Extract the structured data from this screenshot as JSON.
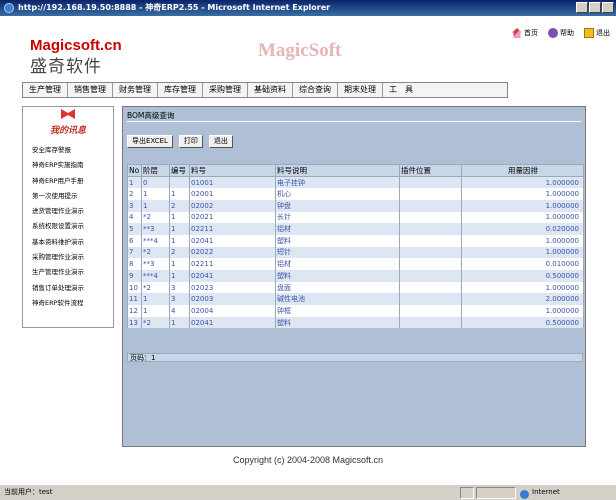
{
  "window": {
    "title": "http://192.168.19.50:8888 - 神奇ERP2.55 - Microsoft Internet Explorer"
  },
  "header": {
    "logo_en": "Magicsoft.cn",
    "logo_cn": "盛奇软件",
    "brand": "MagicSoft",
    "links": [
      {
        "label": "首页",
        "icon": "home-icon"
      },
      {
        "label": "帮助",
        "icon": "help-icon"
      },
      {
        "label": "退出",
        "icon": "exit-icon"
      }
    ]
  },
  "menu": [
    "生产管理",
    "销售管理",
    "财务管理",
    "库存管理",
    "采购管理",
    "基础资料",
    "综合查询",
    "期末处理",
    "工　具"
  ],
  "sidebar": {
    "title": "我的讯息",
    "items": [
      "安全库存警报",
      "神奇ERP实施指南",
      "神奇ERP用户手册",
      "第一次使用提示",
      "进货管理作业演示",
      "系统权限设置演示",
      "基本资料维护演示",
      "采购管理作业演示",
      "生产管理作业演示",
      "销售订单处理演示",
      "神奇ERP软件流程"
    ]
  },
  "main": {
    "title": "BOM高级查询",
    "buttons": [
      "导出EXCEL",
      "打印",
      "退出"
    ],
    "columns": [
      "No",
      "阶层",
      "编号",
      "料号",
      "料号说明",
      "插件位置",
      "用量因排"
    ],
    "rows": [
      [
        "1",
        "0",
        "",
        "01001",
        "电子挂钟",
        "",
        "1.000000"
      ],
      [
        "2",
        "1",
        "1",
        "02001",
        "机心",
        "",
        "1.000000"
      ],
      [
        "3",
        "1",
        "2",
        "02002",
        "钟盘",
        "",
        "1.000000"
      ],
      [
        "4",
        "*2",
        "1",
        "02021",
        "长针",
        "",
        "1.000000"
      ],
      [
        "5",
        "**3",
        "1",
        "02211",
        "铝材",
        "",
        "0.020000"
      ],
      [
        "6",
        "***4",
        "1",
        "02041",
        "塑料",
        "",
        "1.000000"
      ],
      [
        "7",
        "*2",
        "2",
        "02022",
        "短针",
        "",
        "1.000000"
      ],
      [
        "8",
        "**3",
        "1",
        "02211",
        "铝材",
        "",
        "0.010000"
      ],
      [
        "9",
        "***4",
        "1",
        "02041",
        "塑料",
        "",
        "0.500000"
      ],
      [
        "10",
        "*2",
        "3",
        "02023",
        "盘面",
        "",
        "1.000000"
      ],
      [
        "11",
        "1",
        "3",
        "02003",
        "碱性电池",
        "",
        "2.000000"
      ],
      [
        "12",
        "1",
        "4",
        "02004",
        "钟框",
        "",
        "1.000000"
      ],
      [
        "13",
        "*2",
        "1",
        "02041",
        "塑料",
        "",
        "0.500000"
      ]
    ],
    "pager": "页码：1"
  },
  "footer": {
    "copyright": "Copyright (c) 2004-2008 Magicsoft.cn"
  },
  "statusbar": {
    "user": "当前用户：test",
    "zone": "Internet"
  }
}
